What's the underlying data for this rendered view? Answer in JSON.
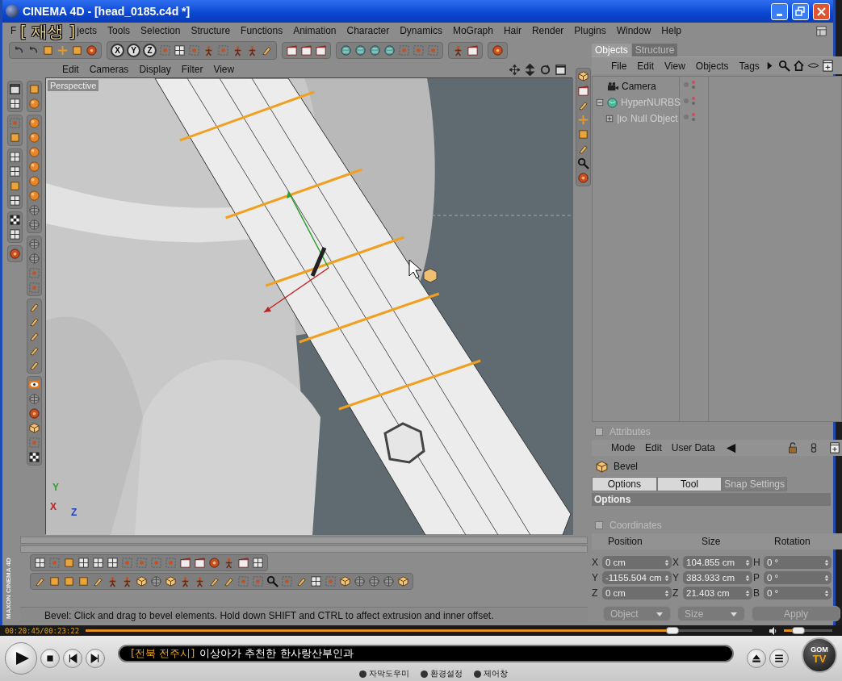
{
  "osd": {
    "label": "[ 재생 ]"
  },
  "window": {
    "title": "CINEMA 4D - [head_0185.c4d *]"
  },
  "menu": [
    "F",
    "jects",
    "Tools",
    "Selection",
    "Structure",
    "Functions",
    "Animation",
    "Character",
    "Dynamics",
    "MoGraph",
    "Hair",
    "Render",
    "Plugins",
    "Window",
    "Help"
  ],
  "toolbar": {
    "axis_buttons": [
      "X",
      "Y",
      "Z"
    ]
  },
  "viewport": {
    "menu": [
      "Edit",
      "Cameras",
      "Display",
      "Filter",
      "View"
    ],
    "label": "Perspective",
    "axis_labels": [
      {
        "label": "Y",
        "color": "#2fa02f"
      },
      {
        "label": "X",
        "color": "#c02020"
      },
      {
        "label": "Z",
        "color": "#2040c0"
      }
    ]
  },
  "object_manager": {
    "tabs": [
      {
        "label": "Objects",
        "selected": true
      },
      {
        "label": "Structure",
        "selected": false
      }
    ],
    "menu": [
      "File",
      "Edit",
      "View",
      "Objects",
      "Tags"
    ],
    "objects": [
      {
        "name": "Camera",
        "kind": "camera",
        "disabled": false
      },
      {
        "name": "HyperNURBS",
        "kind": "nurbs",
        "disabled": true,
        "expanded": true,
        "children": [
          {
            "name": "Null Object",
            "kind": "null",
            "disabled": true,
            "expanded": false
          }
        ]
      }
    ]
  },
  "attributes": {
    "title": "Attributes",
    "checked": false,
    "menu": [
      "Mode",
      "Edit",
      "User Data"
    ],
    "tool": "Bevel",
    "tabs": [
      {
        "label": "Options",
        "selected": true
      },
      {
        "label": "Tool",
        "selected": true
      },
      {
        "label": "Snap Settings",
        "selected": false
      }
    ],
    "section": "Options"
  },
  "coordinates": {
    "title": "Coordinates",
    "checked": false,
    "headers": [
      "Position",
      "Size",
      "Rotation"
    ],
    "rows": [
      {
        "pos_axis": "X",
        "pos": "0 cm",
        "size_axis": "X",
        "size": "104.855 cm",
        "rot_axis": "H",
        "rot": "0 °"
      },
      {
        "pos_axis": "Y",
        "pos": "-1155.504 cm",
        "size_axis": "Y",
        "size": "383.933 cm",
        "rot_axis": "P",
        "rot": "0 °"
      },
      {
        "pos_axis": "Z",
        "pos": "0 cm",
        "size_axis": "Z",
        "size": "21.403 cm",
        "rot_axis": "B",
        "rot": "0 °"
      }
    ],
    "mode_dropdown": "Object",
    "size_dropdown": "Size",
    "apply_button": "Apply"
  },
  "brand": "MAXON CINEMA 4D",
  "status_bar": "Bevel: Click and drag to bevel elements. Hold down SHIFT and CTRL to affect extrusion and inner offset.",
  "player": {
    "time": "00:20:45/00:23:22",
    "progress": {
      "level": 0.88
    },
    "volume": {
      "level": 0.3
    },
    "subtitle_tag": "[전북 전주시]",
    "subtitle": "이상아가 추천한 한사랑산부인과",
    "links": [
      "자막도우미",
      "환경설정",
      "제어창"
    ],
    "logo_top": "GOM",
    "logo_bottom": "TV"
  }
}
